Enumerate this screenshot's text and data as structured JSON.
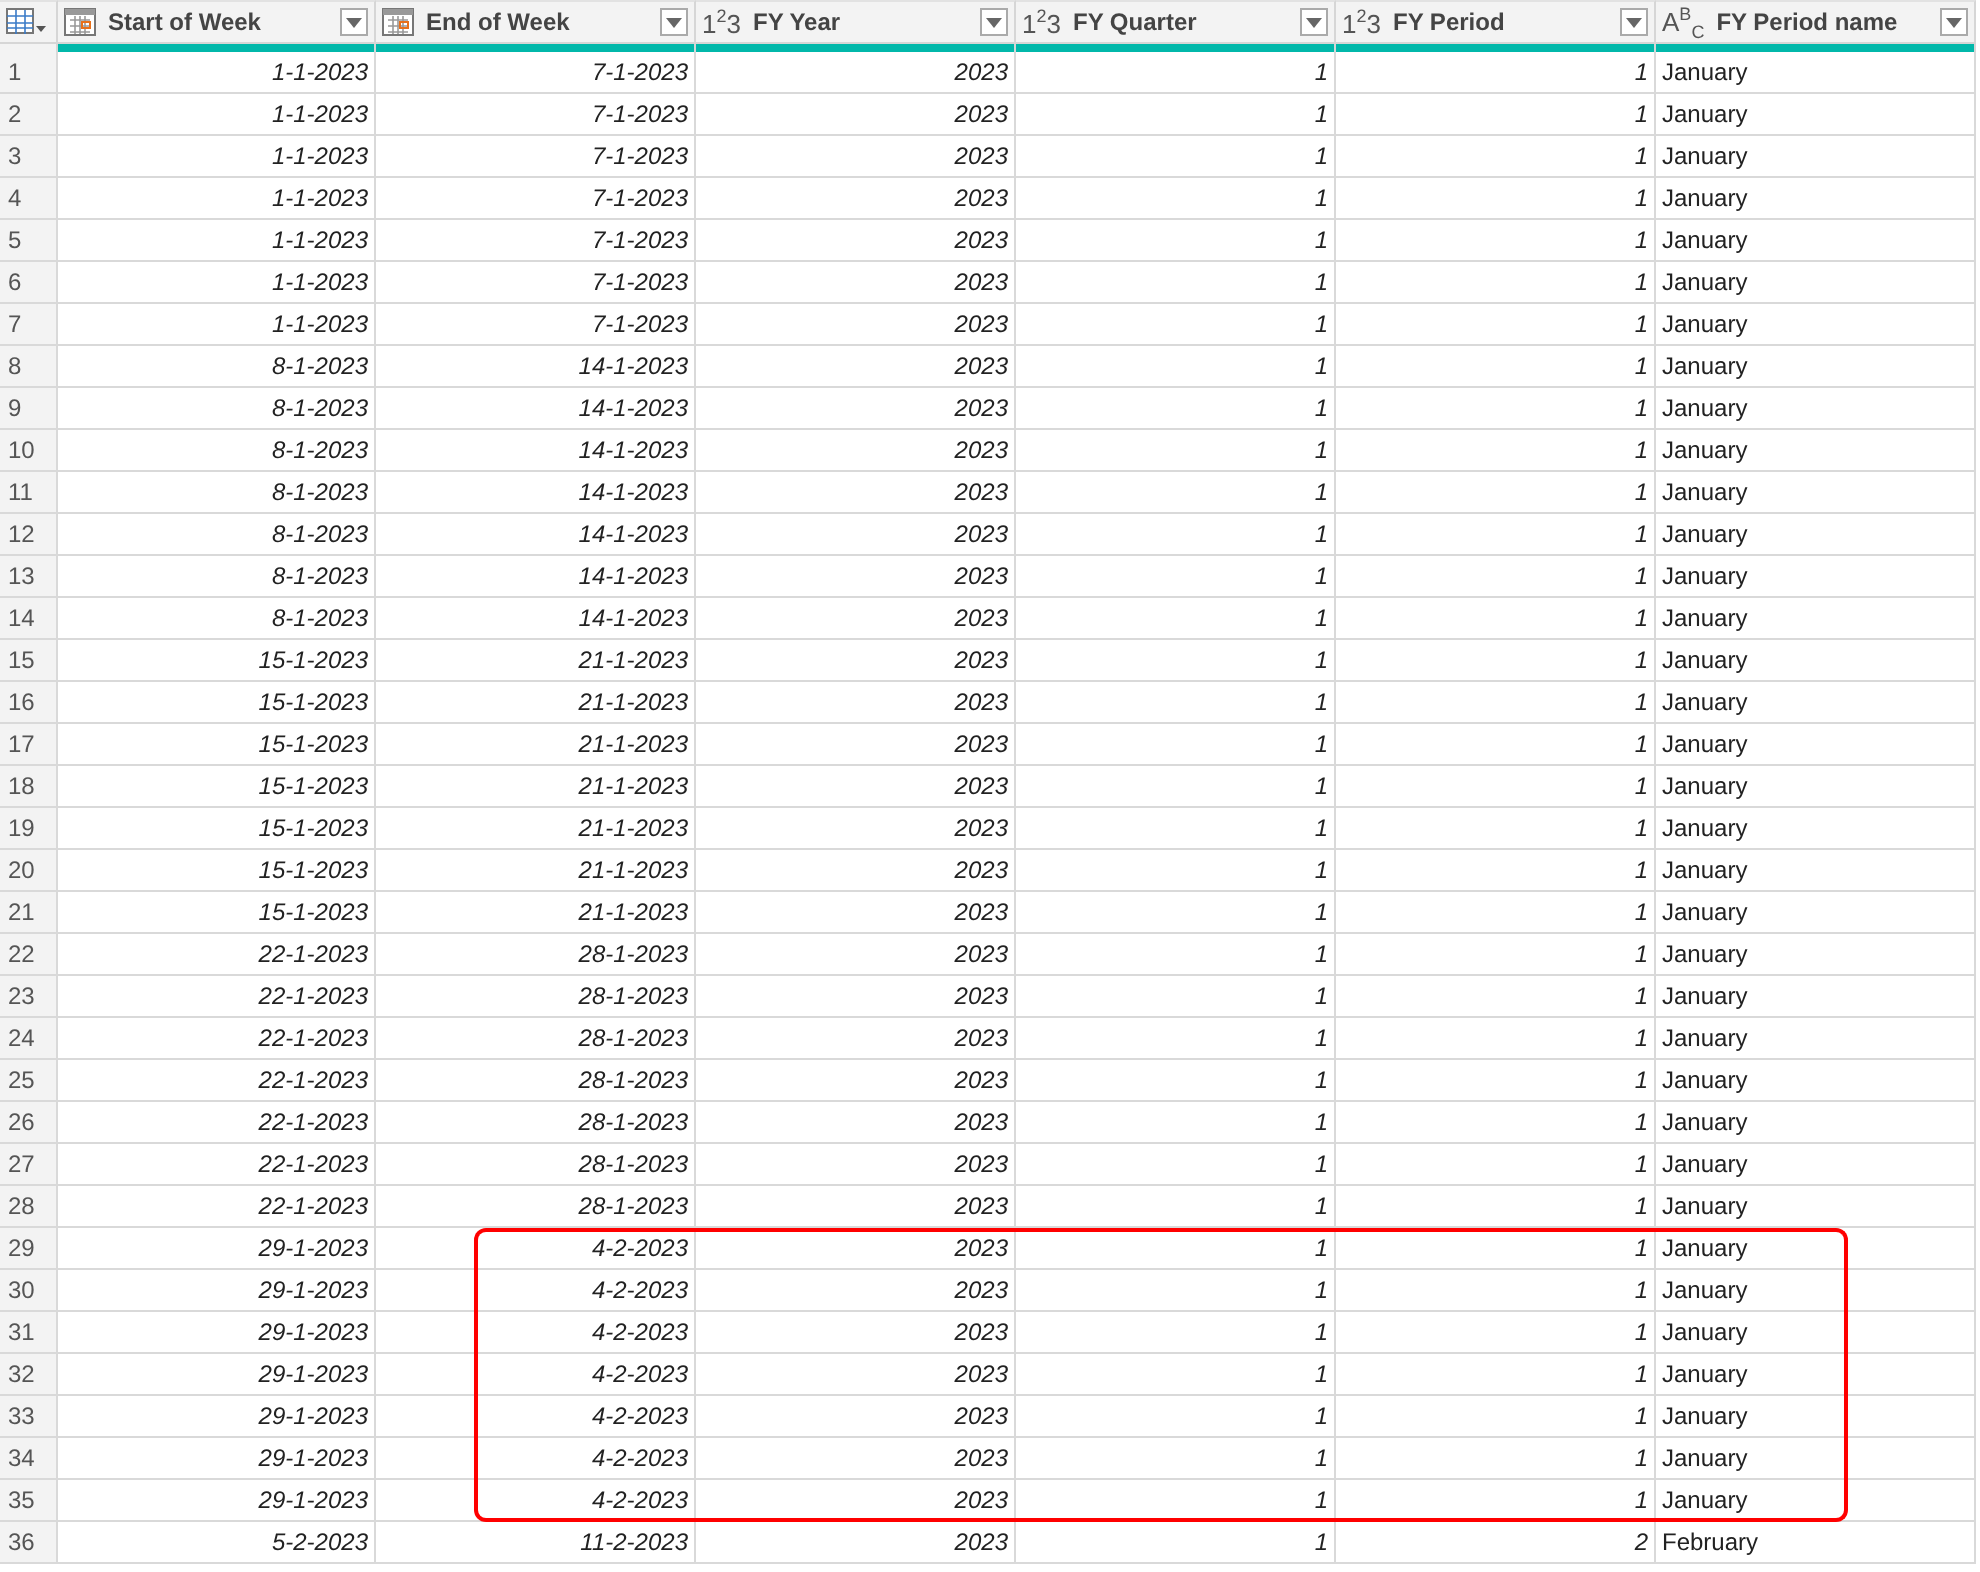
{
  "columns": [
    {
      "label": "Start of Week",
      "kind": "date"
    },
    {
      "label": "End of Week",
      "kind": "date"
    },
    {
      "label": "FY Year",
      "kind": "number",
      "type_label": "1$^{2}$3"
    },
    {
      "label": "FY Quarter",
      "kind": "number",
      "type_label": "1$^{2}$3"
    },
    {
      "label": "FY Period",
      "kind": "number",
      "type_label": "1$^{2}$3"
    },
    {
      "label": "FY Period name",
      "kind": "text",
      "type_label": "A$^{B}$$_{C}$"
    }
  ],
  "rows": [
    {
      "index": "1",
      "cells": [
        "1-1-2023",
        "7-1-2023",
        "2023",
        "1",
        "1",
        "January"
      ],
      "highlighted": false
    },
    {
      "index": "2",
      "cells": [
        "1-1-2023",
        "7-1-2023",
        "2023",
        "1",
        "1",
        "January"
      ],
      "highlighted": false
    },
    {
      "index": "3",
      "cells": [
        "1-1-2023",
        "7-1-2023",
        "2023",
        "1",
        "1",
        "January"
      ],
      "highlighted": false
    },
    {
      "index": "4",
      "cells": [
        "1-1-2023",
        "7-1-2023",
        "2023",
        "1",
        "1",
        "January"
      ],
      "highlighted": false
    },
    {
      "index": "5",
      "cells": [
        "1-1-2023",
        "7-1-2023",
        "2023",
        "1",
        "1",
        "January"
      ],
      "highlighted": false
    },
    {
      "index": "6",
      "cells": [
        "1-1-2023",
        "7-1-2023",
        "2023",
        "1",
        "1",
        "January"
      ],
      "highlighted": false
    },
    {
      "index": "7",
      "cells": [
        "1-1-2023",
        "7-1-2023",
        "2023",
        "1",
        "1",
        "January"
      ],
      "highlighted": false
    },
    {
      "index": "8",
      "cells": [
        "8-1-2023",
        "14-1-2023",
        "2023",
        "1",
        "1",
        "January"
      ],
      "highlighted": false
    },
    {
      "index": "9",
      "cells": [
        "8-1-2023",
        "14-1-2023",
        "2023",
        "1",
        "1",
        "January"
      ],
      "highlighted": false
    },
    {
      "index": "10",
      "cells": [
        "8-1-2023",
        "14-1-2023",
        "2023",
        "1",
        "1",
        "January"
      ],
      "highlighted": false
    },
    {
      "index": "11",
      "cells": [
        "8-1-2023",
        "14-1-2023",
        "2023",
        "1",
        "1",
        "January"
      ],
      "highlighted": false
    },
    {
      "index": "12",
      "cells": [
        "8-1-2023",
        "14-1-2023",
        "2023",
        "1",
        "1",
        "January"
      ],
      "highlighted": false
    },
    {
      "index": "13",
      "cells": [
        "8-1-2023",
        "14-1-2023",
        "2023",
        "1",
        "1",
        "January"
      ],
      "highlighted": false
    },
    {
      "index": "14",
      "cells": [
        "8-1-2023",
        "14-1-2023",
        "2023",
        "1",
        "1",
        "January"
      ],
      "highlighted": false
    },
    {
      "index": "15",
      "cells": [
        "15-1-2023",
        "21-1-2023",
        "2023",
        "1",
        "1",
        "January"
      ],
      "highlighted": false
    },
    {
      "index": "16",
      "cells": [
        "15-1-2023",
        "21-1-2023",
        "2023",
        "1",
        "1",
        "January"
      ],
      "highlighted": false
    },
    {
      "index": "17",
      "cells": [
        "15-1-2023",
        "21-1-2023",
        "2023",
        "1",
        "1",
        "January"
      ],
      "highlighted": false
    },
    {
      "index": "18",
      "cells": [
        "15-1-2023",
        "21-1-2023",
        "2023",
        "1",
        "1",
        "January"
      ],
      "highlighted": false
    },
    {
      "index": "19",
      "cells": [
        "15-1-2023",
        "21-1-2023",
        "2023",
        "1",
        "1",
        "January"
      ],
      "highlighted": false
    },
    {
      "index": "20",
      "cells": [
        "15-1-2023",
        "21-1-2023",
        "2023",
        "1",
        "1",
        "January"
      ],
      "highlighted": false
    },
    {
      "index": "21",
      "cells": [
        "15-1-2023",
        "21-1-2023",
        "2023",
        "1",
        "1",
        "January"
      ],
      "highlighted": false
    },
    {
      "index": "22",
      "cells": [
        "22-1-2023",
        "28-1-2023",
        "2023",
        "1",
        "1",
        "January"
      ],
      "highlighted": false
    },
    {
      "index": "23",
      "cells": [
        "22-1-2023",
        "28-1-2023",
        "2023",
        "1",
        "1",
        "January"
      ],
      "highlighted": false
    },
    {
      "index": "24",
      "cells": [
        "22-1-2023",
        "28-1-2023",
        "2023",
        "1",
        "1",
        "January"
      ],
      "highlighted": false
    },
    {
      "index": "25",
      "cells": [
        "22-1-2023",
        "28-1-2023",
        "2023",
        "1",
        "1",
        "January"
      ],
      "highlighted": false
    },
    {
      "index": "26",
      "cells": [
        "22-1-2023",
        "28-1-2023",
        "2023",
        "1",
        "1",
        "January"
      ],
      "highlighted": false
    },
    {
      "index": "27",
      "cells": [
        "22-1-2023",
        "28-1-2023",
        "2023",
        "1",
        "1",
        "January"
      ],
      "highlighted": false
    },
    {
      "index": "28",
      "cells": [
        "22-1-2023",
        "28-1-2023",
        "2023",
        "1",
        "1",
        "January"
      ],
      "highlighted": false
    },
    {
      "index": "29",
      "cells": [
        "29-1-2023",
        "4-2-2023",
        "2023",
        "1",
        "1",
        "January"
      ],
      "highlighted": true
    },
    {
      "index": "30",
      "cells": [
        "29-1-2023",
        "4-2-2023",
        "2023",
        "1",
        "1",
        "January"
      ],
      "highlighted": true
    },
    {
      "index": "31",
      "cells": [
        "29-1-2023",
        "4-2-2023",
        "2023",
        "1",
        "1",
        "January"
      ],
      "highlighted": true
    },
    {
      "index": "32",
      "cells": [
        "29-1-2023",
        "4-2-2023",
        "2023",
        "1",
        "1",
        "January"
      ],
      "highlighted": true
    },
    {
      "index": "33",
      "cells": [
        "29-1-2023",
        "4-2-2023",
        "2023",
        "1",
        "1",
        "January"
      ],
      "highlighted": true
    },
    {
      "index": "34",
      "cells": [
        "29-1-2023",
        "4-2-2023",
        "2023",
        "1",
        "1",
        "January"
      ],
      "highlighted": true
    },
    {
      "index": "35",
      "cells": [
        "29-1-2023",
        "4-2-2023",
        "2023",
        "1",
        "1",
        "January"
      ],
      "highlighted": true
    },
    {
      "index": "36",
      "cells": [
        "5-2-2023",
        "11-2-2023",
        "2023",
        "1",
        "2",
        "February"
      ],
      "highlighted": false
    }
  ]
}
